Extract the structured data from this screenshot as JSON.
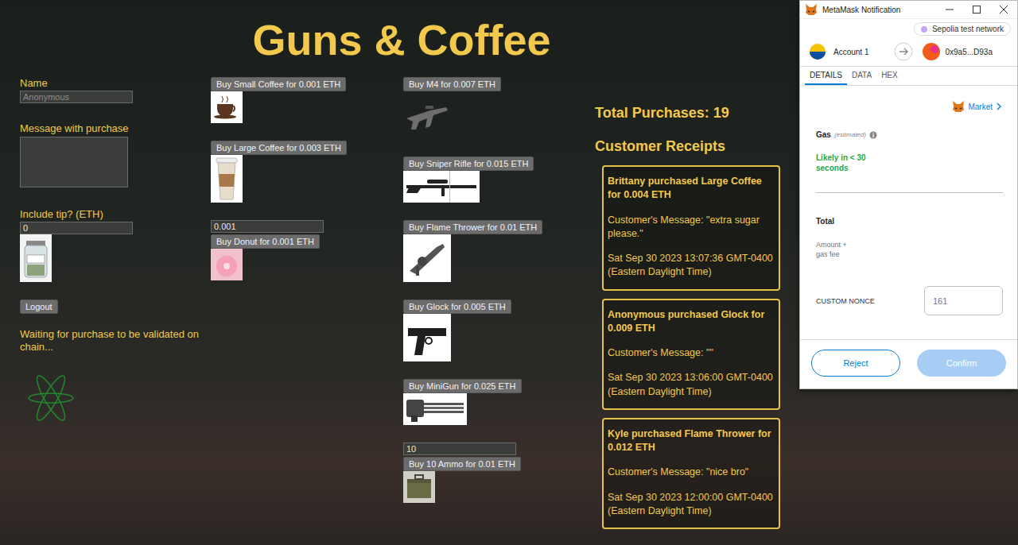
{
  "title": "Guns & Coffee",
  "form": {
    "name_label": "Name",
    "name_placeholder": "Anonymous",
    "message_label": "Message with purchase",
    "tip_label": "Include tip? (ETH)",
    "tip_value": "0",
    "logout": "Logout",
    "status": "Waiting for purchase to be validated on chain..."
  },
  "coffee_menu": [
    {
      "kind": "plain",
      "button": "Buy Small Coffee for 0.001 ETH"
    },
    {
      "kind": "plain",
      "button": "Buy Large Coffee for 0.003 ETH"
    },
    {
      "kind": "quantity",
      "quantity": "0.001",
      "button": "Buy Donut for 0.001 ETH"
    }
  ],
  "weapon_menu": [
    {
      "kind": "plain",
      "button": "Buy M4 for 0.007 ETH"
    },
    {
      "kind": "plain",
      "button": "Buy Sniper Rifle for 0.015 ETH"
    },
    {
      "kind": "plain",
      "button": "Buy Flame Thrower for 0.01 ETH"
    },
    {
      "kind": "plain",
      "button": "Buy Glock for 0.005 ETH"
    },
    {
      "kind": "plain",
      "button": "Buy MiniGun for 0.025 ETH"
    },
    {
      "kind": "quantity",
      "quantity": "10",
      "button": "Buy 10 Ammo for 0.01 ETH"
    }
  ],
  "total_purchases": "Total Purchases: 19",
  "receipts_title": "Customer Receipts",
  "receipts": [
    {
      "headline": "Brittany purchased Large Coffee for 0.004 ETH",
      "message": "Customer's Message: \"extra sugar please.\"",
      "time": "Sat Sep 30 2023 13:07:36 GMT-0400 (Eastern Daylight Time)"
    },
    {
      "headline": "Anonymous purchased Glock for 0.009 ETH",
      "message": "Customer's Message: \"\"",
      "time": "Sat Sep 30 2023 13:06:00 GMT-0400 (Eastern Daylight Time)"
    },
    {
      "headline": "Kyle purchased Flame Thrower for 0.012 ETH",
      "message": "Customer's Message: \"nice bro\"",
      "time": "Sat Sep 30 2023 12:00:00 GMT-0400 (Eastern Daylight Time)"
    }
  ],
  "metamask": {
    "window_title": "MetaMask Notification",
    "network": "Sepolia test network",
    "from_account": "Account 1",
    "to_address": "0x9a5...D93a",
    "tabs": [
      {
        "label": "DETAILS",
        "selected": true
      },
      {
        "label": "DATA",
        "selected": false
      },
      {
        "label": "HEX",
        "selected": false
      }
    ],
    "market": "Market",
    "gas_label": "Gas",
    "gas_note": "(estimated)",
    "gas_speed": "Likely in < 30 seconds",
    "total_label": "Total",
    "total_note": "Amount + gas fee",
    "nonce_label": "CUSTOM NONCE",
    "nonce_placeholder": "161",
    "buttons": [
      {
        "label": "Reject",
        "disabled": false
      },
      {
        "label": "Confirm",
        "disabled": true
      }
    ]
  }
}
